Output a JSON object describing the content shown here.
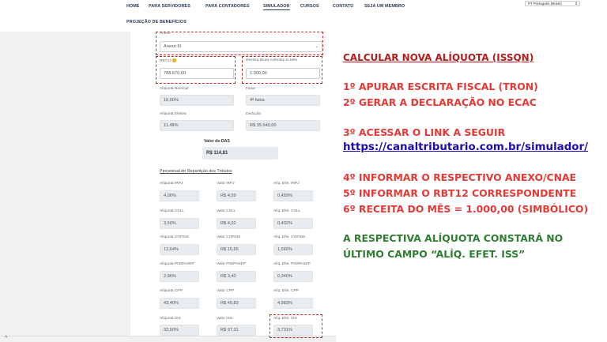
{
  "nav": {
    "items": [
      "HOME",
      "PARA SERVIDORES",
      "PARA CONTADORES",
      "SIMULADOR",
      "CURSOS",
      "CONTATO",
      "SEJA UM MEMBRO"
    ],
    "sub_item": "PROJEÇÃO DE BENEFÍCIOS",
    "language_select": "PT Português (Brasil)"
  },
  "form": {
    "anexo_label": "Anexo",
    "anexo_value": "Anexo III",
    "rbt12_label": "RBT12",
    "rbt12_value": "788.670,60",
    "receita_label": "Receita Bruta Auferida no Mês",
    "receita_value": "1.000,00",
    "aliquota_nominal_label": "Alíquota Nominal",
    "aliquota_nominal_value": "16,00%",
    "faixa_label": "Faixa",
    "faixa_value": "4ª faixa",
    "aliquota_efetiva_label": "Alíquota Efetiva",
    "aliquota_efetiva_value": "11,48%",
    "deducao_label": "Dedução",
    "deducao_value": "R$ 35.640,00",
    "valor_das_label": "Valor do DAS",
    "valor_das_value": "R$ 114,81",
    "reparticao_title": "Percentual de Repartição dos Tributos",
    "tributos": [
      {
        "aliq_label": "Alíquota IRPJ",
        "aliq": "4,00%",
        "valor_label": "Valor IRPJ",
        "valor": "R$ 4,59",
        "efet_label": "Alíq. Efet. IRPJ",
        "efet": "0,459%"
      },
      {
        "aliq_label": "Alíquota CSLL",
        "aliq": "3,50%",
        "valor_label": "Valor CSLL",
        "valor": "R$ 4,02",
        "efet_label": "Alíq. Efet. CSLL",
        "efet": "0,402%"
      },
      {
        "aliq_label": "Alíquota COFINS",
        "aliq": "13,64%",
        "valor_label": "Valor COFINS",
        "valor": "R$ 15,66",
        "efet_label": "Alíq. Efet. COFINS",
        "efet": "1,566%"
      },
      {
        "aliq_label": "Alíquota PIS/PASEP",
        "aliq": "2,96%",
        "valor_label": "Valor PIS/PASEP",
        "valor": "R$ 3,40",
        "efet_label": "Alíq. Efet. PIS/PASEP",
        "efet": "0,340%"
      },
      {
        "aliq_label": "Alíquota CPP",
        "aliq": "43,40%",
        "valor_label": "Valor CPP",
        "valor": "R$ 49,83",
        "efet_label": "Alíq. Efet. CPP",
        "efet": "4,983%"
      },
      {
        "aliq_label": "Alíquota ISS",
        "aliq": "32,50%",
        "valor_label": "Valor ISS",
        "valor": "R$ 37,31",
        "efet_label": "Alíq. Efet. ISS",
        "efet": "3,731%"
      }
    ]
  },
  "instructions": {
    "title": "CALCULAR NOVA ALÍQUOTA (ISSQN)",
    "step1": "1º APURAR ESCRITA FISCAL (TRON)",
    "step2": "2º GERAR A DECLARAÇÃO NO ECAC",
    "step3": "3º ACESSAR O LINK A SEGUIR",
    "link": "https://canaltributario.com.br/simulador/",
    "step4": "4º INFORMAR O RESPECTIVO ANEXO/CNAE",
    "step5": "5º INFORMAR O RBT12 CORRESPONDENTE",
    "step6": "6º RECEITA DO MÊS = 1.000,00 (SIMBÓLICO)",
    "note_line1": "A RESPECTIVA ALÍQUOTA CONSTARÁ NO",
    "note_line2": "ÚLTIMO CAMPO “ALÍQ. EFET. ISS”"
  },
  "colors": {
    "nav_text": "#2b3a55",
    "highlight_border": "#c62828",
    "instruction_red": "#e53935",
    "link_blue": "#1a0dab",
    "note_green": "#2e7d32"
  }
}
